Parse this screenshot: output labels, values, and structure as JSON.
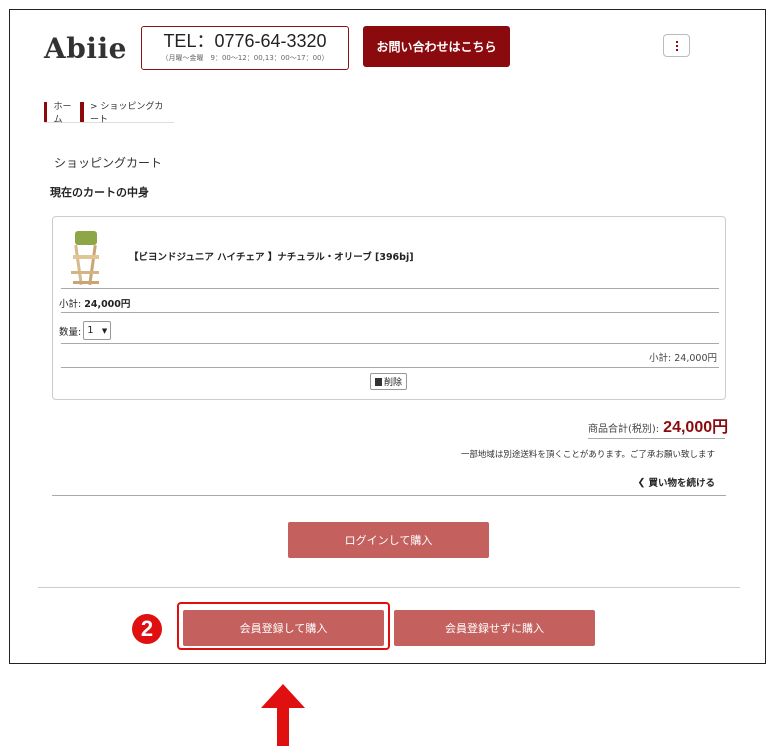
{
  "header": {
    "logo": "Abiie",
    "tel": "TEL：0776-64-3320",
    "hours": "（月曜〜金曜　9：00〜12：00,13：00〜17：00）",
    "contact_button": "お問い合わせはこちら"
  },
  "breadcrumb": {
    "home": "ホーム",
    "current": "> ショッピングカート"
  },
  "page": {
    "heading": "ショッピングカート",
    "section_title": "現在のカートの中身"
  },
  "cart": {
    "item": {
      "name": "【ビヨンドジュニア ハイチェア 】ナチュラル・オリーブ [396bj]",
      "subtotal_label": "小計:",
      "subtotal_value": "24,000円",
      "qty_label": "数量:",
      "qty_value": "1",
      "subtotal_right": "小計: 24,000円",
      "delete_label": "削除"
    },
    "total_label": "商品合計(税別):",
    "total_value": "24,000円",
    "shipping_note": "一部地域は別途送料を頂くことがあります。ご了承お願い致します",
    "continue_label": "買い物を続ける"
  },
  "buttons": {
    "login": "ログインして購入",
    "register": "会員登録して購入",
    "guest": "会員登録せずに購入"
  },
  "annotation": {
    "step": "2"
  },
  "colors": {
    "brand": "#8b0a0e",
    "button": "#c4605e",
    "highlight": "#e01010"
  }
}
